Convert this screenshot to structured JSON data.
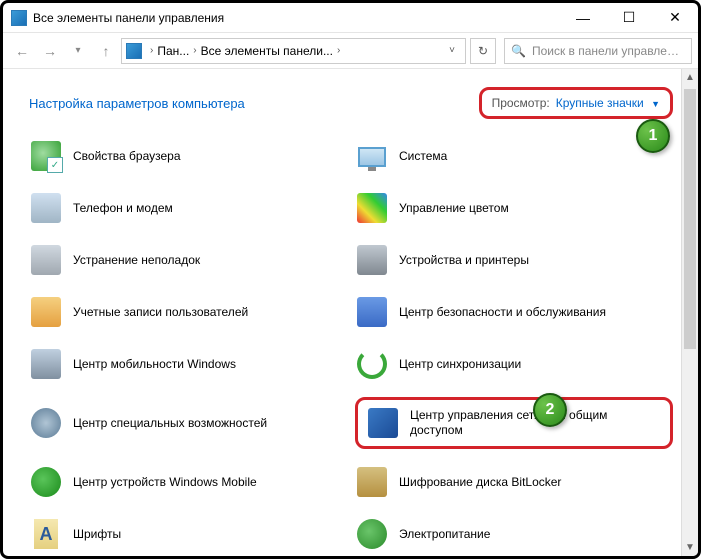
{
  "titlebar": {
    "title": "Все элементы панели управления"
  },
  "nav": {
    "crumb1": "Пан...",
    "crumb2": "Все элементы панели...",
    "search_placeholder": "Поиск в панели управления"
  },
  "header": {
    "title": "Настройка параметров компьютера",
    "view_label": "Просмотр:",
    "view_value": "Крупные значки"
  },
  "items": {
    "left": [
      "Свойства браузера",
      "Телефон и модем",
      "Устранение неполадок",
      "Учетные записи пользователей",
      "Центр мобильности Windows",
      "Центр специальных возможностей",
      "Центр устройств Windows Mobile",
      "Шрифты"
    ],
    "right": [
      "Система",
      "Управление цветом",
      "Устройства и принтеры",
      "Центр безопасности и обслуживания",
      "Центр синхронизации",
      "Центр управления сетями и общим доступом",
      "Шифрование диска BitLocker",
      "Электропитание"
    ]
  },
  "callouts": {
    "c1": "1",
    "c2": "2"
  }
}
